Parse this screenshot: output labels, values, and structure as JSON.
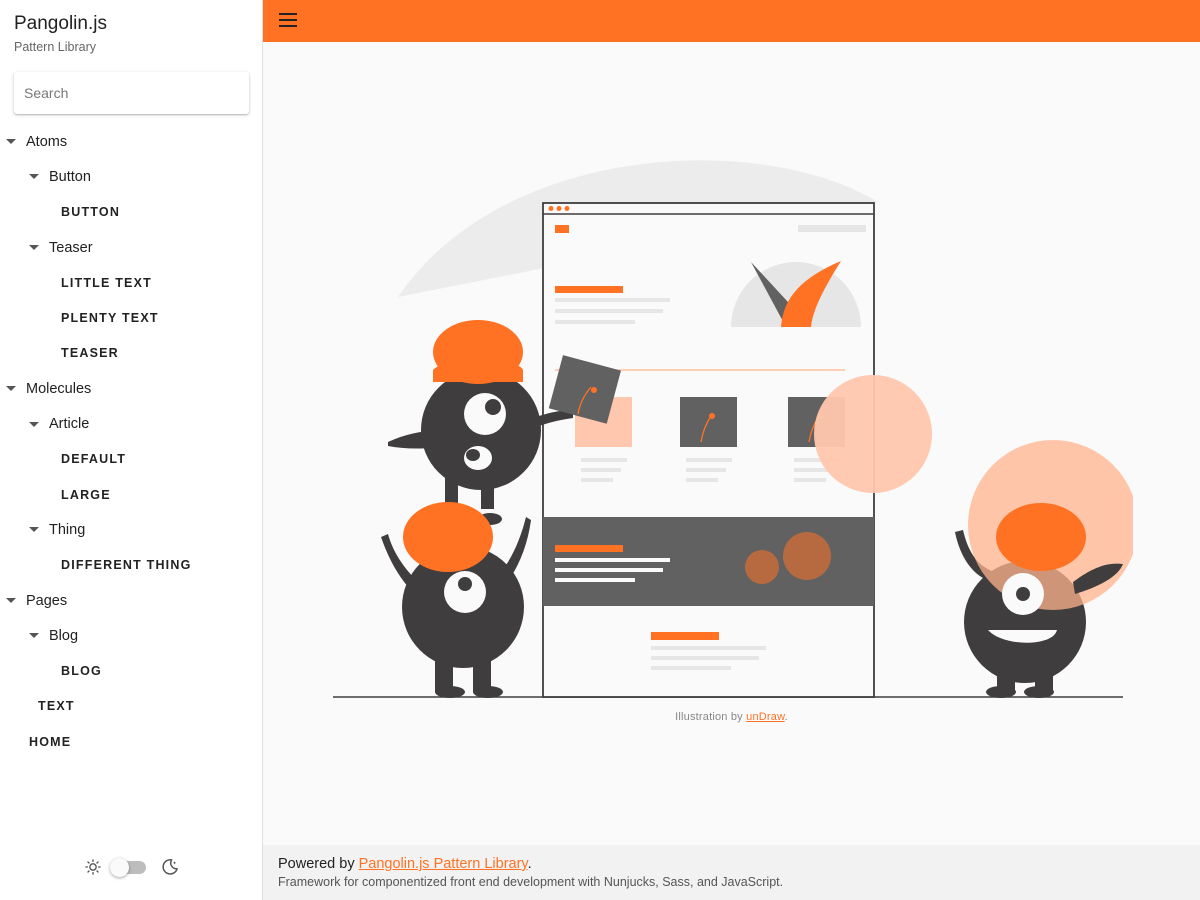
{
  "brand": {
    "title": "Pangolin.js",
    "subtitle": "Pattern Library"
  },
  "search": {
    "placeholder": "Search",
    "value": ""
  },
  "nav": [
    {
      "label": "Atoms",
      "type": "group",
      "level": 0
    },
    {
      "label": "Button",
      "type": "group",
      "level": 1
    },
    {
      "label": "BUTTON",
      "type": "leaf",
      "level": 2
    },
    {
      "label": "Teaser",
      "type": "group",
      "level": 1
    },
    {
      "label": "LITTLE TEXT",
      "type": "leaf",
      "level": 2
    },
    {
      "label": "PLENTY TEXT",
      "type": "leaf",
      "level": 2
    },
    {
      "label": "TEASER",
      "type": "leaf",
      "level": 2
    },
    {
      "label": "Molecules",
      "type": "group",
      "level": 0
    },
    {
      "label": "Article",
      "type": "group",
      "level": 1
    },
    {
      "label": "DEFAULT",
      "type": "leaf",
      "level": 2
    },
    {
      "label": "LARGE",
      "type": "leaf",
      "level": 2
    },
    {
      "label": "Thing",
      "type": "group",
      "level": 1
    },
    {
      "label": "DIFFERENT THING",
      "type": "leaf",
      "level": 2
    },
    {
      "label": "Pages",
      "type": "group",
      "level": 0
    },
    {
      "label": "Blog",
      "type": "group",
      "level": 1
    },
    {
      "label": "BLOG",
      "type": "leaf",
      "level": 2
    },
    {
      "label": "TEXT",
      "type": "leaf",
      "level": 1
    },
    {
      "label": "HOME",
      "type": "leaf",
      "level": 0
    }
  ],
  "theme": {
    "light_icon": "sun-icon",
    "dark_icon": "moon-icon",
    "dark_mode": false
  },
  "topbar": {
    "menu_icon": "hamburger-menu-icon"
  },
  "illustration": {
    "credit_prefix": "Illustration by ",
    "credit_link": "unDraw",
    "credit_suffix": "."
  },
  "footer": {
    "powered_prefix": "Powered by ",
    "powered_link": "Pangolin.js Pattern Library",
    "powered_suffix": ".",
    "description": "Framework for componentized front end development with Nunjucks, Sass, and JavaScript."
  },
  "colors": {
    "accent": "#ff7224",
    "accent_light": "#ffc0a0",
    "dark": "#3f3d3d",
    "gray": "#616161"
  }
}
